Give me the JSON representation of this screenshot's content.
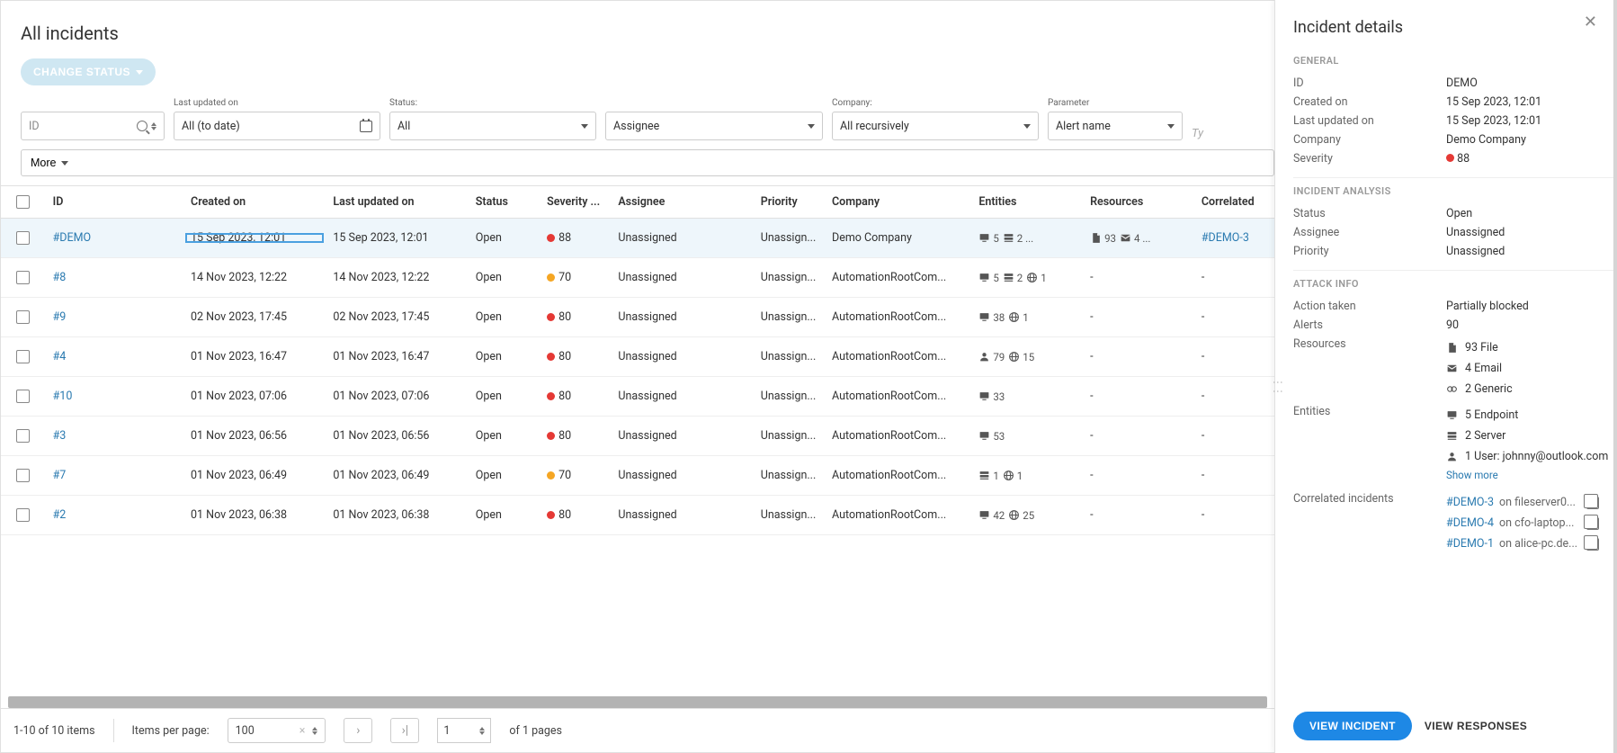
{
  "page_title": "All incidents",
  "toolbar": {
    "change_status": "CHANGE STATUS"
  },
  "filters": {
    "id_placeholder": "ID",
    "last_updated_label": "Last updated on",
    "last_updated_value": "All (to date)",
    "status_label": "Status:",
    "status_value": "All",
    "assignee_value": "Assignee",
    "company_label": "Company:",
    "company_value": "All recursively",
    "parameter_label": "Parameter",
    "parameter_value": "Alert name",
    "type_partial": "Ty",
    "more": "More"
  },
  "columns": {
    "id": "ID",
    "created": "Created on",
    "updated": "Last updated on",
    "status": "Status",
    "severity": "Severity ...",
    "assignee": "Assignee",
    "priority": "Priority",
    "company": "Company",
    "entities": "Entities",
    "resources": "Resources",
    "correlated": "Correlated"
  },
  "rows": [
    {
      "id": "#DEMO",
      "created": "15 Sep 2023, 12:01",
      "updated": "15 Sep 2023, 12:01",
      "status": "Open",
      "sev_color": "sev-red",
      "sev": "88",
      "assignee": "Unassigned",
      "priority": "Unassign...",
      "company": "Demo Company",
      "entities": [
        {
          "ic": "endpoint",
          "n": "5"
        },
        {
          "ic": "server",
          "n": "2 ..."
        }
      ],
      "resources": [
        {
          "ic": "file",
          "n": "93"
        },
        {
          "ic": "email",
          "n": "4 ..."
        }
      ],
      "correlated": "#DEMO-3",
      "selected": true
    },
    {
      "id": "#8",
      "created": "14 Nov 2023, 12:22",
      "updated": "14 Nov 2023, 12:22",
      "status": "Open",
      "sev_color": "sev-orange",
      "sev": "70",
      "assignee": "Unassigned",
      "priority": "Unassign...",
      "company": "AutomationRootCom...",
      "entities": [
        {
          "ic": "endpoint",
          "n": "5"
        },
        {
          "ic": "server",
          "n": "2"
        },
        {
          "ic": "globe",
          "n": "1"
        }
      ],
      "resources": [],
      "res_dash": "-",
      "correlated": "-"
    },
    {
      "id": "#9",
      "created": "02 Nov 2023, 17:45",
      "updated": "02 Nov 2023, 17:45",
      "status": "Open",
      "sev_color": "sev-red",
      "sev": "80",
      "assignee": "Unassigned",
      "priority": "Unassign...",
      "company": "AutomationRootCom...",
      "entities": [
        {
          "ic": "endpoint",
          "n": "38"
        },
        {
          "ic": "globe",
          "n": "1"
        }
      ],
      "resources": [],
      "res_dash": "-",
      "correlated": "-"
    },
    {
      "id": "#4",
      "created": "01 Nov 2023, 16:47",
      "updated": "01 Nov 2023, 16:47",
      "status": "Open",
      "sev_color": "sev-red",
      "sev": "80",
      "assignee": "Unassigned",
      "priority": "Unassign...",
      "company": "AutomationRootCom...",
      "entities": [
        {
          "ic": "user",
          "n": "79"
        },
        {
          "ic": "globe",
          "n": "15"
        }
      ],
      "resources": [],
      "res_dash": "-",
      "correlated": "-"
    },
    {
      "id": "#10",
      "created": "01 Nov 2023, 07:06",
      "updated": "01 Nov 2023, 07:06",
      "status": "Open",
      "sev_color": "sev-red",
      "sev": "80",
      "assignee": "Unassigned",
      "priority": "Unassign...",
      "company": "AutomationRootCom...",
      "entities": [
        {
          "ic": "endpoint",
          "n": "33"
        }
      ],
      "resources": [],
      "res_dash": "-",
      "correlated": "-"
    },
    {
      "id": "#3",
      "created": "01 Nov 2023, 06:56",
      "updated": "01 Nov 2023, 06:56",
      "status": "Open",
      "sev_color": "sev-red",
      "sev": "80",
      "assignee": "Unassigned",
      "priority": "Unassign...",
      "company": "AutomationRootCom...",
      "entities": [
        {
          "ic": "endpoint",
          "n": "53"
        }
      ],
      "resources": [],
      "res_dash": "-",
      "correlated": "-"
    },
    {
      "id": "#7",
      "created": "01 Nov 2023, 06:49",
      "updated": "01 Nov 2023, 06:49",
      "status": "Open",
      "sev_color": "sev-orange",
      "sev": "70",
      "assignee": "Unassigned",
      "priority": "Unassign...",
      "company": "AutomationRootCom...",
      "entities": [
        {
          "ic": "server",
          "n": "1"
        },
        {
          "ic": "globe",
          "n": "1"
        }
      ],
      "resources": [],
      "res_dash": "-",
      "correlated": "-"
    },
    {
      "id": "#2",
      "created": "01 Nov 2023, 06:38",
      "updated": "01 Nov 2023, 06:38",
      "status": "Open",
      "sev_color": "sev-red",
      "sev": "80",
      "assignee": "Unassigned",
      "priority": "Unassign...",
      "company": "AutomationRootCom...",
      "entities": [
        {
          "ic": "endpoint",
          "n": "42"
        },
        {
          "ic": "globe",
          "n": "25"
        }
      ],
      "resources": [],
      "res_dash": "-",
      "correlated": "-"
    }
  ],
  "pager": {
    "summary": "1-10 of 10 items",
    "items_per_page_label": "Items per page:",
    "items_per_page_value": "100",
    "page_value": "1",
    "of_pages": "of 1 pages"
  },
  "panel": {
    "title": "Incident details",
    "general_label": "GENERAL",
    "analysis_label": "INCIDENT ANALYSIS",
    "attack_label": "ATTACK INFO",
    "id_k": "ID",
    "id_v": "DEMO",
    "created_k": "Created on",
    "created_v": "15 Sep 2023, 12:01",
    "updated_k": "Last updated on",
    "updated_v": "15 Sep 2023, 12:01",
    "company_k": "Company",
    "company_v": "Demo Company",
    "severity_k": "Severity",
    "severity_v": "88",
    "severity_color": "sev-red",
    "status_k": "Status",
    "status_v": "Open",
    "assignee_k": "Assignee",
    "assignee_v": "Unassigned",
    "priority_k": "Priority",
    "priority_v": "Unassigned",
    "action_k": "Action taken",
    "action_v": "Partially blocked",
    "alerts_k": "Alerts",
    "alerts_v": "90",
    "resources_k": "Resources",
    "resources": [
      {
        "ic": "file",
        "txt": "93 File"
      },
      {
        "ic": "email",
        "txt": "4 Email"
      },
      {
        "ic": "generic",
        "txt": "2 Generic"
      }
    ],
    "entities_k": "Entities",
    "entities": [
      {
        "ic": "endpoint",
        "txt": "5 Endpoint"
      },
      {
        "ic": "server",
        "txt": "2 Server"
      },
      {
        "ic": "user",
        "txt": "1 User: johnny@outlook.com"
      }
    ],
    "show_more": "Show more",
    "correlated_k": "Correlated incidents",
    "correlated": [
      {
        "id": "#DEMO-3",
        "on": "on fileserver0..."
      },
      {
        "id": "#DEMO-4",
        "on": "on cfo-laptop..."
      },
      {
        "id": "#DEMO-1",
        "on": "on alice-pc.de..."
      }
    ],
    "view_incident": "VIEW INCIDENT",
    "view_responses": "VIEW RESPONSES"
  }
}
